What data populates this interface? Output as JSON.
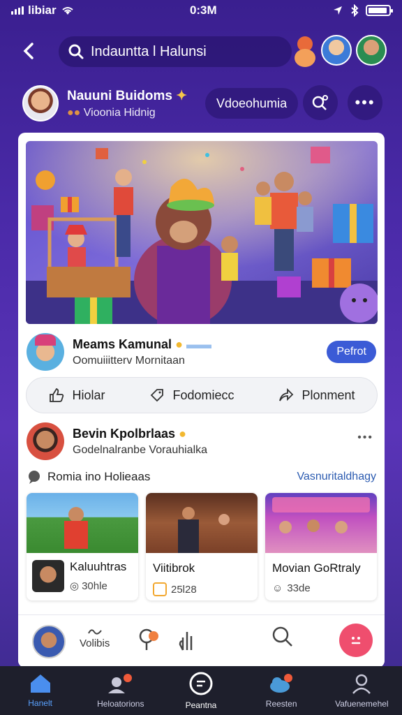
{
  "status": {
    "carrier": "libiar",
    "time": "0:3M"
  },
  "nav": {
    "search_value": "Indauntta l Halunsi"
  },
  "profile": {
    "name": "Nauuni Buidoms",
    "subtitle": "Vioonia Hidnig",
    "primary_button": "Vdoeohumia"
  },
  "post": {
    "author": "Meams Kamunal",
    "subtitle": "Oomuiiitterv Mornitaan",
    "follow_label": "Pefrot"
  },
  "actions": [
    {
      "label": "Hiolar"
    },
    {
      "label": "Fodomiecc"
    },
    {
      "label": "Plonment"
    }
  ],
  "comment": {
    "author": "Bevin Kpolbrlaas",
    "subtitle": "Godelnalranbe Vorauhialka"
  },
  "section": {
    "title": "Romia ino Holieaas",
    "link": "Vasnuritaldhagy"
  },
  "tiles": [
    {
      "title": "Kaluuhtras",
      "meta": "30hle"
    },
    {
      "title": "Viitibrok",
      "meta": "25l28"
    },
    {
      "title": "Movian GoRtraly",
      "meta": "33de"
    }
  ],
  "quickbar": {
    "label": "Volibis"
  },
  "tabs": [
    {
      "label": "Hanelt"
    },
    {
      "label": "Heloatorions"
    },
    {
      "label": "Peantna"
    },
    {
      "label": "Reesten"
    },
    {
      "label": "Vafuenemehel"
    }
  ],
  "colors": {
    "accent": "#3b5bd6",
    "tab_active": "#5aa2ff",
    "fab": "#ef4e6e"
  }
}
